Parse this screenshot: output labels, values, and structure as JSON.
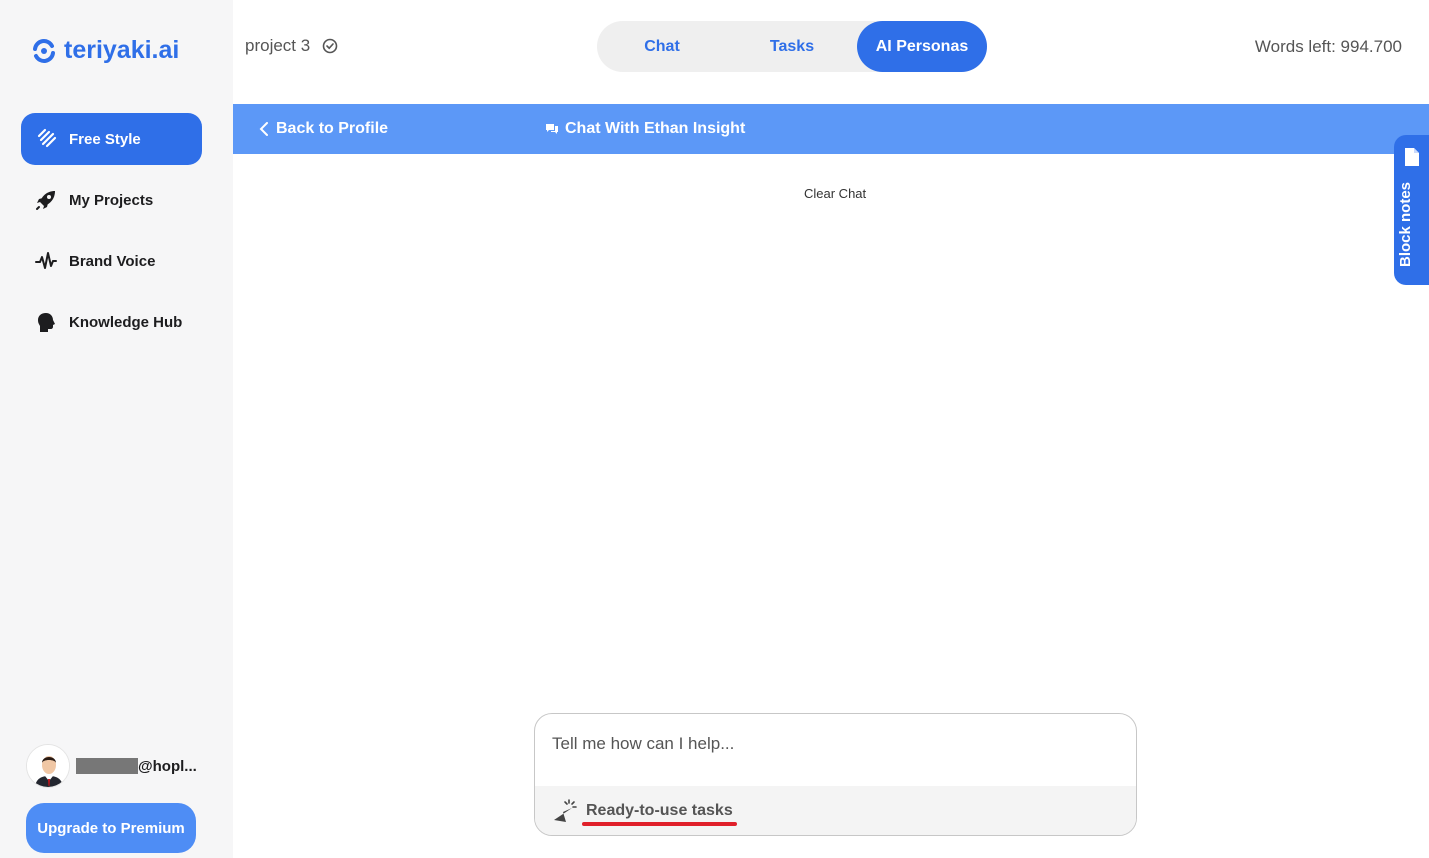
{
  "app": {
    "logo_text": "teriyaki.ai",
    "brand_color": "#2f6fe8"
  },
  "sidebar": {
    "items": [
      {
        "label": "Free Style",
        "icon": "pen-icon",
        "active": true
      },
      {
        "label": "My Projects",
        "icon": "rocket-icon",
        "active": false
      },
      {
        "label": "Brand Voice",
        "icon": "waveform-icon",
        "active": false
      },
      {
        "label": "Knowledge Hub",
        "icon": "head-icon",
        "active": false
      }
    ],
    "user_email": "@hopl...",
    "upgrade_label": "Upgrade to Premium"
  },
  "header": {
    "project_name": "project 3",
    "tabs": [
      {
        "label": "Chat",
        "active": false
      },
      {
        "label": "Tasks",
        "active": false
      },
      {
        "label": "AI Personas",
        "active": true
      }
    ],
    "words_left": "Words left: 994.700"
  },
  "chat_bar": {
    "back_label": "Back to Profile",
    "title": "Chat With Ethan Insight"
  },
  "main": {
    "clear_chat_label": "Clear Chat",
    "block_notes_label": "Block notes"
  },
  "composer": {
    "placeholder": "Tell me how can I help...",
    "value": "",
    "tasks_label": "Ready-to-use tasks"
  }
}
